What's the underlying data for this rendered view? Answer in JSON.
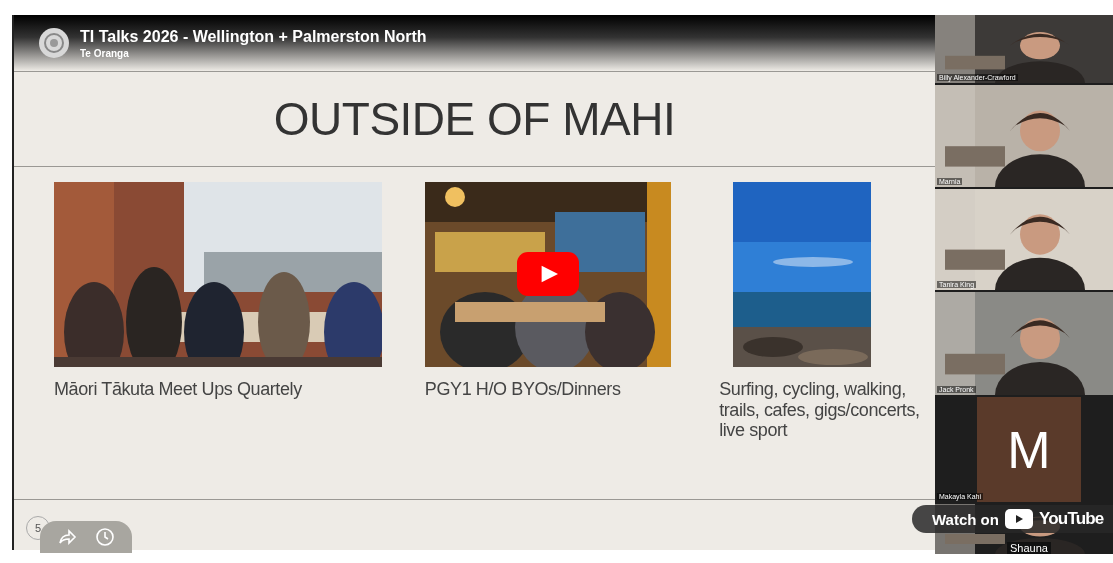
{
  "video": {
    "title": "TI Talks 2026 - Wellington + Palmerston North",
    "channel": "Te Oranga",
    "watch_on": "Watch on",
    "brand": "YouTube"
  },
  "slide": {
    "title": "OUTSIDE OF MAHI",
    "number": "5",
    "columns": [
      {
        "caption": "Māori Tākuta Meet Ups Quartely",
        "kind": "restaurant"
      },
      {
        "caption": "PGY1 H/O BYOs/Dinners",
        "kind": "bar"
      },
      {
        "caption": "Surfing, cycling, walking, trails, cafes, gigs/concerts, live sport",
        "kind": "beach"
      }
    ]
  },
  "participants": [
    {
      "name": "Billy Alexander-Crawford",
      "kind": "video"
    },
    {
      "name": "Marnia",
      "kind": "video"
    },
    {
      "name": "Tanira King",
      "kind": "video"
    },
    {
      "name": "Jack Pronk",
      "kind": "video"
    },
    {
      "name": "Makayla Kahi",
      "kind": "avatar",
      "initial": "M"
    },
    {
      "name": "Shauna",
      "kind": "video"
    }
  ]
}
